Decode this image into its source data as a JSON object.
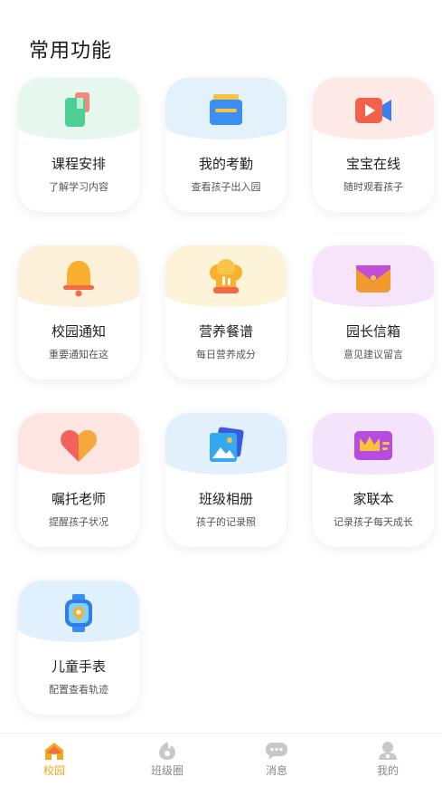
{
  "section_title": "常用功能",
  "cards": [
    {
      "title": "课程安排",
      "subtitle": "了解学习内容",
      "icon": "book-icon",
      "tint": "#e6f7ee"
    },
    {
      "title": "我的考勤",
      "subtitle": "查看孩子出入园",
      "icon": "folder-icon",
      "tint": "#e3f1fb"
    },
    {
      "title": "宝宝在线",
      "subtitle": "随时观看孩子",
      "icon": "video-camera-icon",
      "tint": "#fde9e6"
    },
    {
      "title": "校园通知",
      "subtitle": "重要通知在这",
      "icon": "bell-icon",
      "tint": "#fdf0db"
    },
    {
      "title": "营养餐谱",
      "subtitle": "每日营养成分",
      "icon": "chef-hat-icon",
      "tint": "#fdf3d8"
    },
    {
      "title": "园长信箱",
      "subtitle": "意见建议留言",
      "icon": "envelope-icon",
      "tint": "#f6e4fa"
    },
    {
      "title": "嘱托老师",
      "subtitle": "提醒孩子状况",
      "icon": "heart-icon",
      "tint": "#fde6e2"
    },
    {
      "title": "班级相册",
      "subtitle": "孩子的记录照",
      "icon": "photo-album-icon",
      "tint": "#e2f0fb"
    },
    {
      "title": "家联本",
      "subtitle": "记录孩子每天成长",
      "icon": "crown-card-icon",
      "tint": "#f3e3fb"
    },
    {
      "title": "儿童手表",
      "subtitle": "配置查看轨迹",
      "icon": "smartwatch-icon",
      "tint": "#e0f0fc"
    }
  ],
  "tabbar": {
    "tabs": [
      {
        "label": "校园",
        "icon": "school-icon",
        "active": true
      },
      {
        "label": "班级圈",
        "icon": "circle-icon",
        "active": false
      },
      {
        "label": "消息",
        "icon": "chat-icon",
        "active": false
      },
      {
        "label": "我的",
        "icon": "user-icon",
        "active": false
      }
    ]
  },
  "colors": {
    "accent": "#f2a81d",
    "inactive": "#c8c8c8"
  }
}
